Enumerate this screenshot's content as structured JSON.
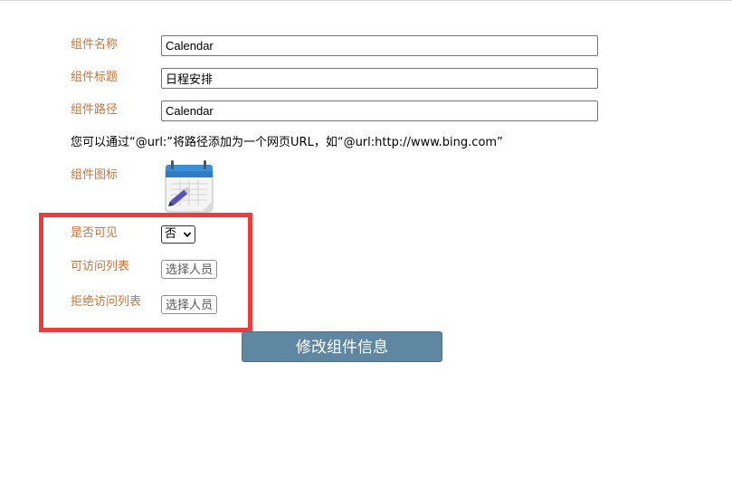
{
  "form": {
    "name_label": "组件名称",
    "name_value": "Calendar",
    "title_label": "组件标题",
    "title_value": "日程安排",
    "path_label": "组件路径",
    "path_value": "Calendar",
    "path_hint": "您可以通过“@url:”将路径添加为一个网页URL，如“@url:http://www.bing.com”",
    "icon_label": "组件图标",
    "icon_name": "calendar-icon",
    "visible_label": "是否可见",
    "visible_selected": "否",
    "allow_list_label": "可访问列表",
    "allow_list_button": "选择人员",
    "deny_list_label": "拒绝访问列表",
    "deny_list_button": "选择人员",
    "submit_label": "修改组件信息"
  },
  "colors": {
    "label": "#c8743a",
    "submit_bg": "#5f87a1",
    "highlight_border": "#ee3b3b"
  }
}
